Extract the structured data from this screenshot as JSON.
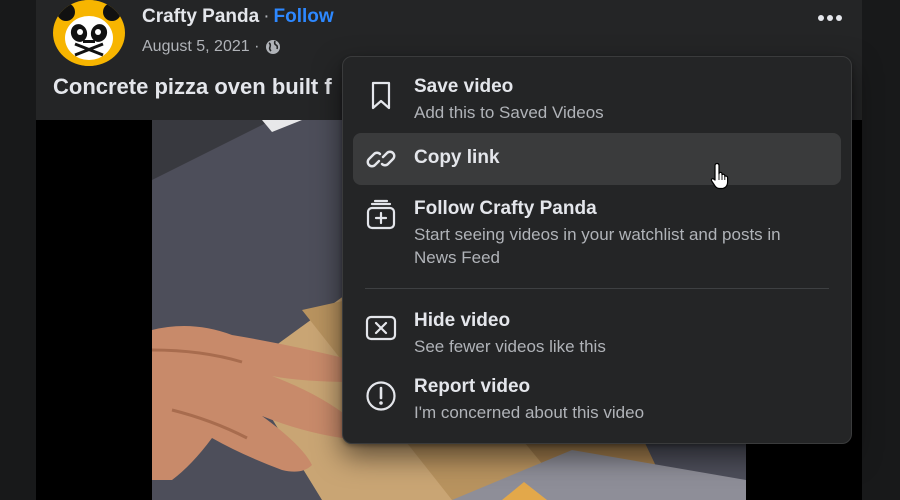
{
  "post": {
    "author": "Crafty Panda",
    "separator": "·",
    "follow_label": "Follow",
    "date": "August 5, 2021 ·",
    "title": "Concrete pizza oven built f"
  },
  "icons": {
    "more": "more-horizontal-icon",
    "privacy": "globe-icon"
  },
  "menu": {
    "items": [
      {
        "title": "Save video",
        "subtitle": "Add this to Saved Videos",
        "icon": "bookmark-icon"
      },
      {
        "title": "Copy link",
        "subtitle": "",
        "icon": "link-icon",
        "highlighted": true
      },
      {
        "title": "Follow Crafty Panda",
        "subtitle": "Start seeing videos in your watchlist and posts in News Feed",
        "icon": "follow-page-icon"
      },
      {
        "title": "Hide video",
        "subtitle": "See fewer videos like this",
        "icon": "hide-x-icon"
      },
      {
        "title": "Report video",
        "subtitle": "I'm concerned about this video",
        "icon": "report-alert-icon"
      }
    ]
  },
  "colors": {
    "page_bg": "#18191a",
    "card_bg": "#242526",
    "menu_bg": "#242526",
    "highlight_bg": "#3a3b3c",
    "text_primary": "#e4e6eb",
    "text_secondary": "#b0b3b8",
    "link_blue": "#2d88ff",
    "avatar_yellow": "#f7b500"
  }
}
